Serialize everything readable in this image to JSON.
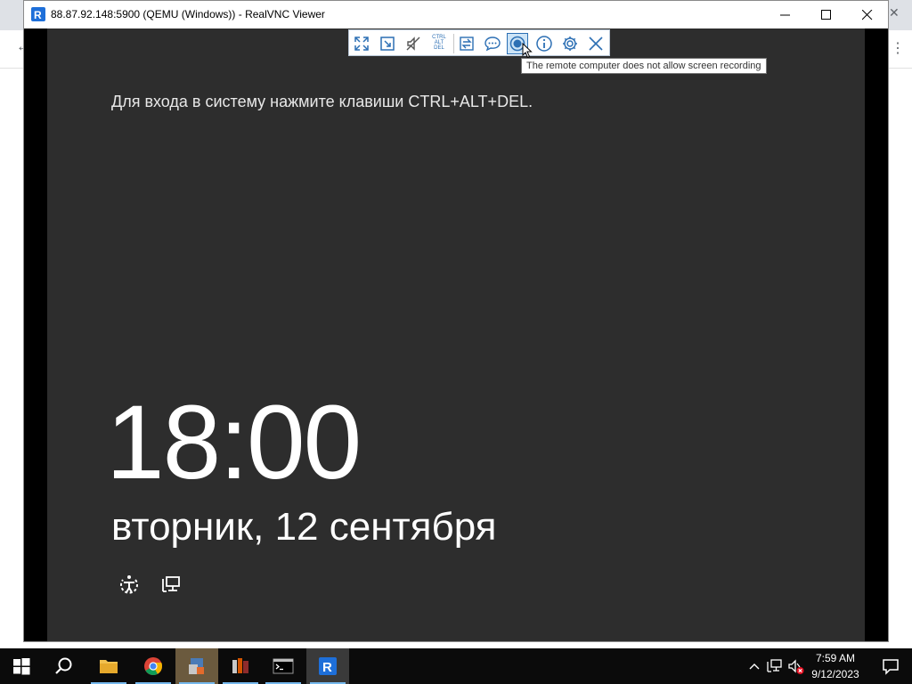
{
  "window": {
    "title": "88.87.92.148:5900 (QEMU (Windows)) - RealVNC Viewer"
  },
  "toolbar": {
    "buttons": [
      {
        "name": "full-screen",
        "icon": "expand-icon"
      },
      {
        "name": "scale",
        "icon": "scale-icon"
      },
      {
        "name": "audio",
        "icon": "speaker-muted-icon"
      },
      {
        "name": "ctrl-alt-del",
        "label_lines": [
          "CTRL",
          "ALT",
          "DEL"
        ]
      },
      {
        "name": "file-transfer",
        "icon": "transfer-icon"
      },
      {
        "name": "chat",
        "icon": "chat-icon"
      },
      {
        "name": "record",
        "icon": "record-icon"
      },
      {
        "name": "info",
        "icon": "info-icon"
      },
      {
        "name": "settings",
        "icon": "gear-icon"
      },
      {
        "name": "close-session",
        "icon": "close-icon"
      }
    ],
    "tooltip": "The remote computer does not allow screen recording"
  },
  "remote_screen": {
    "logon_hint": "Для входа в систему нажмите клавиши CTRL+ALT+DEL.",
    "time": "18:00",
    "date": "вторник, 12 сентября"
  },
  "taskbar": {
    "clock_time": "7:59 AM",
    "clock_date": "9/12/2023"
  },
  "colors": {
    "lock_screen_bg": "#2d2d2d",
    "accent": "#1e6fd9",
    "taskbar_bg": "#0b0b0b"
  }
}
